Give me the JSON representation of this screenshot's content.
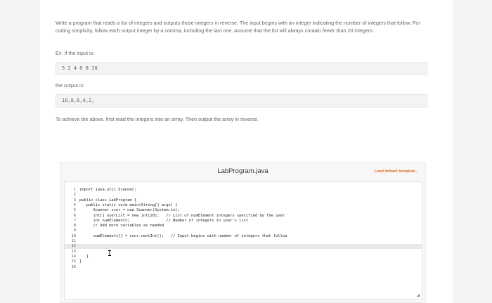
{
  "problem": {
    "description": "Write a program that reads a list of integers and outputs those integers in reverse. The input begins with an integer indicating the number of integers that follow. For coding simplicity, follow each output integer by a comma, including the last one. Assume that the list will always contain fewer than 20 integers.",
    "example_label": "Ex: If the input is:",
    "example_input": "5 2 4 6 8 10",
    "output_label": "the output is:",
    "example_output": "10,8,6,4,2,",
    "hint": "To achieve the above, first read the integers into an array. Then output the array in reverse."
  },
  "lab": {
    "filename": "LabProgram.java",
    "load_template": "Load default template...",
    "highlighted_line": 12,
    "lines": [
      {
        "n": "1",
        "code": "import java.util.Scanner;"
      },
      {
        "n": "2",
        "code": ""
      },
      {
        "n": "3",
        "code": "public class LabProgram {"
      },
      {
        "n": "4",
        "code": "   public static void main(String[] args) {"
      },
      {
        "n": "5",
        "code": "      Scanner scnr = new Scanner(System.in);"
      },
      {
        "n": "6",
        "code": "      int[] userList = new int[20];   // List of numElement integers specified by the user"
      },
      {
        "n": "7",
        "code": "      int numElements;                // Number of integers in user's list"
      },
      {
        "n": "8",
        "code": "      // Add more variables as needed"
      },
      {
        "n": "9",
        "code": ""
      },
      {
        "n": "10",
        "code": "      numElements[] = scnr.nextInt();   // Input begins with number of integers that follow"
      },
      {
        "n": "11",
        "code": ""
      },
      {
        "n": "12",
        "code": ""
      },
      {
        "n": "13",
        "code": ""
      },
      {
        "n": "14",
        "code": "   }"
      },
      {
        "n": "15",
        "code": "}"
      },
      {
        "n": "16",
        "code": ""
      }
    ]
  }
}
